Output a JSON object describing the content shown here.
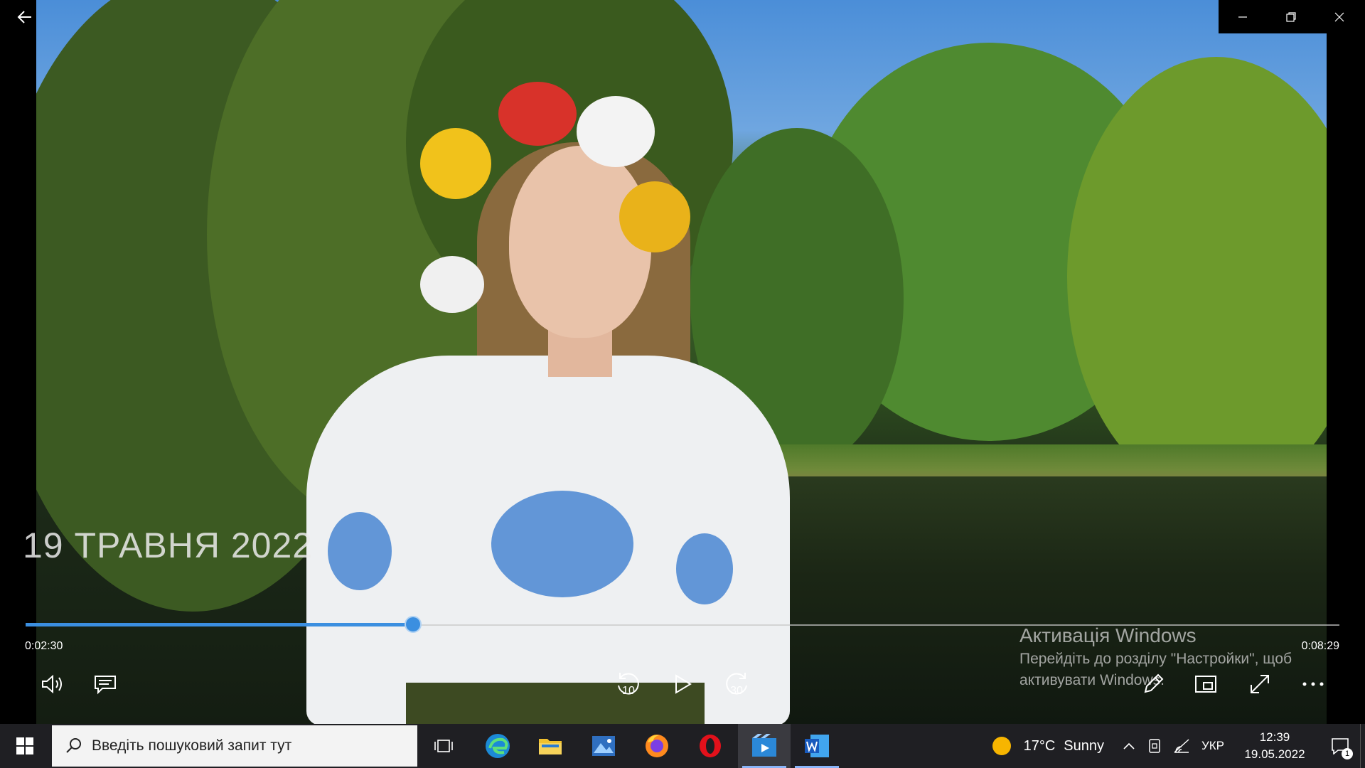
{
  "video": {
    "caption_date": "19 ТРАВНЯ 2022",
    "elapsed": "0:02:30",
    "total": "0:08:29",
    "progress_fraction": 0.295,
    "accent_color": "#3b8fe0"
  },
  "controls": {
    "skip_back_value": "10",
    "skip_forward_value": "30"
  },
  "activation": {
    "title": "Активація Windows",
    "subtitle": "Перейдіть до розділу \"Настройки\", щоб активувати Windows."
  },
  "taskbar": {
    "search_placeholder": "Введіть пошуковий запит тут",
    "weather_temp": "17°C",
    "weather_cond": "Sunny",
    "language": "УКР",
    "time": "12:39",
    "date": "19.05.2022",
    "notifications_count": "1"
  }
}
